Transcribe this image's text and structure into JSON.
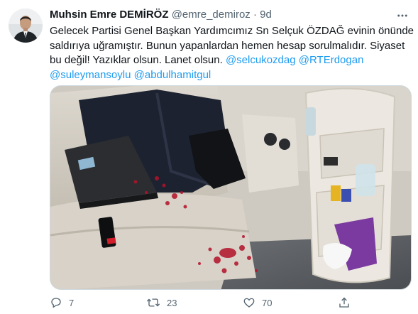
{
  "author": {
    "name": "Muhsin Emre DEMİRÖZ",
    "handle": "@emre_demiroz",
    "separator": "·",
    "time": "9d"
  },
  "tweet": {
    "lines": [
      "Gelecek Partisi Genel Başkan Yardımcımız Sn Selçuk ÖZDAĞ evinin önünde",
      "saldırıya uğramıştır. Bunun yapanlardan hemen hesap sorulmalıdır. Siyaset"
    ],
    "line3_text": "bu değil! Yazıklar olsun. Lanet olsun. ",
    "mentions": [
      "@selcukozdag",
      "@RTErdogan",
      "@suleymansoylu",
      "@abdulhamitgul"
    ]
  },
  "actions": {
    "reply_count": "7",
    "retweet_count": "23",
    "like_count": "70"
  },
  "icons": {
    "more": "more-icon",
    "reply": "reply-icon",
    "retweet": "retweet-icon",
    "like": "heart-icon",
    "share": "share-icon"
  },
  "colors": {
    "link": "#1d9bf0",
    "muted": "#536471",
    "text": "#0f1419"
  }
}
